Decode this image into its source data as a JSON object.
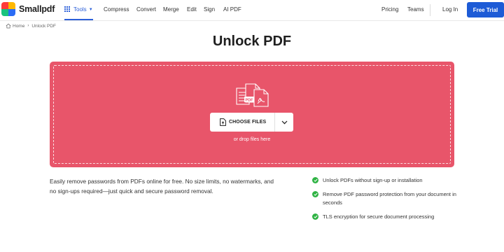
{
  "brand": {
    "name": "Smallpdf",
    "logo_colors": [
      "#ff3b3b",
      "#ffb800",
      "#19c37d",
      "#2b6cf5"
    ]
  },
  "nav": {
    "tools_label": "Tools",
    "links": [
      "Compress",
      "Convert",
      "Merge",
      "Edit",
      "Sign",
      "AI PDF"
    ],
    "right_links": [
      "Pricing",
      "Teams"
    ],
    "login_label": "Log In",
    "cta_label": "Free Trial"
  },
  "breadcrumb": {
    "home": "Home",
    "current": "Unlock PDF"
  },
  "page": {
    "title": "Unlock PDF"
  },
  "dropzone": {
    "button_label": "CHOOSE FILES",
    "hint": "or drop files here",
    "color": "#e8556a"
  },
  "description": "Easily remove passwords from PDFs online for free. No size limits, no watermarks, and no sign-ups required—just quick and secure password removal.",
  "features": [
    "Unlock PDFs without sign-up or installation",
    "Remove PDF password protection from your document in seconds",
    "TLS encryption for secure document processing"
  ],
  "colors": {
    "accent": "#1d5bd6",
    "check": "#2fb344"
  }
}
